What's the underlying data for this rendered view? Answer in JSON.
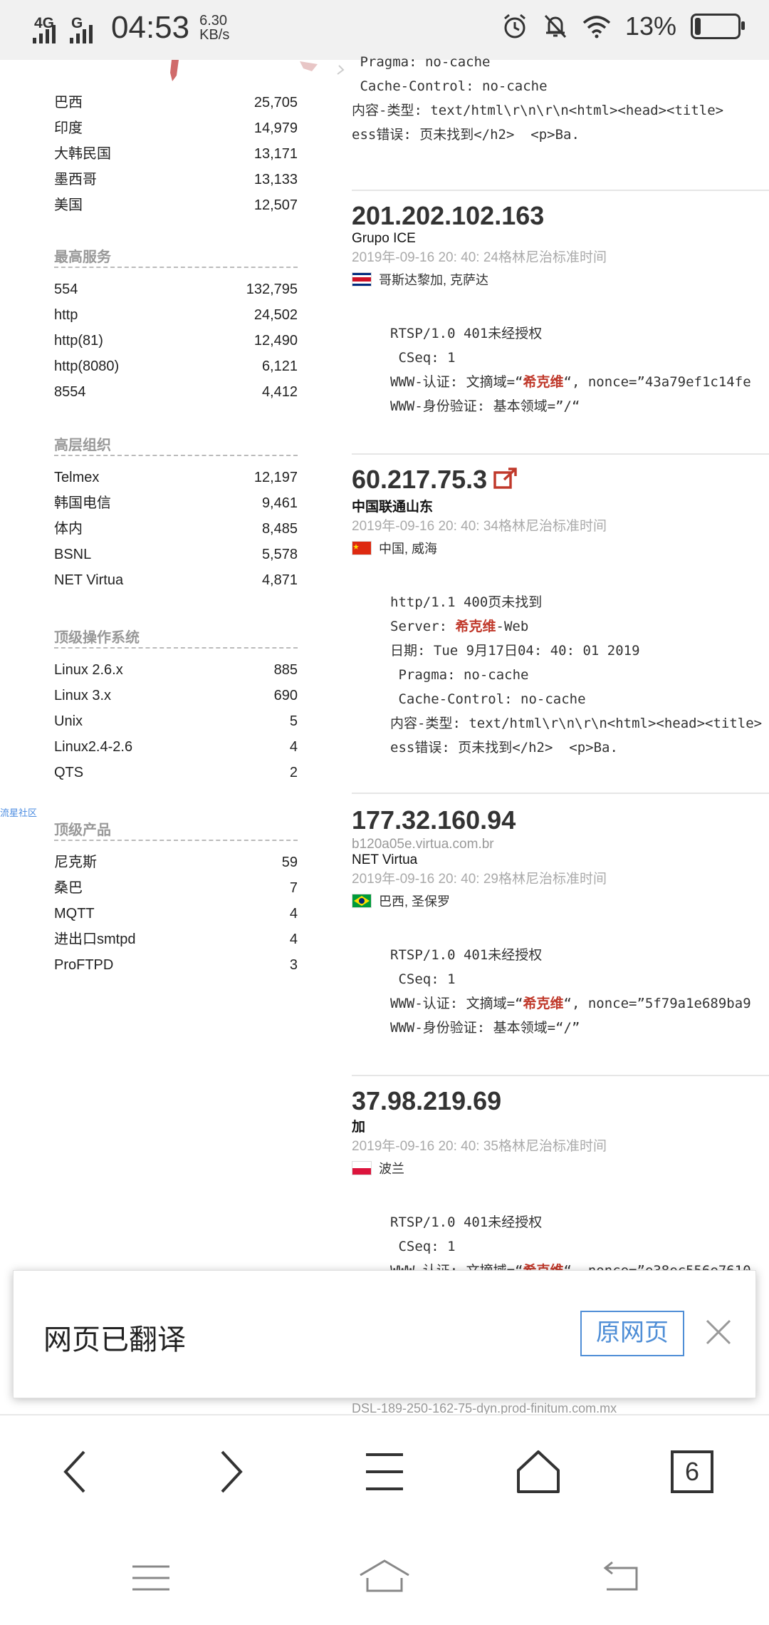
{
  "status_bar": {
    "network1": "4G",
    "network2": "G",
    "time": "04:53",
    "speed_value": "6.30",
    "speed_unit": "KB/s",
    "battery_percent": "13%",
    "battery_level": 0.13
  },
  "facets": [
    {
      "title": "",
      "rows": [
        {
          "label": "巴西",
          "value": "25,705"
        },
        {
          "label": "印度",
          "value": "14,979"
        },
        {
          "label": "大韩民国",
          "value": "13,171"
        },
        {
          "label": "墨西哥",
          "value": "13,133"
        },
        {
          "label": "美国",
          "value": "12,507"
        }
      ]
    },
    {
      "title": "最高服务",
      "rows": [
        {
          "label": "554",
          "value": "132,795"
        },
        {
          "label": "http",
          "value": "24,502"
        },
        {
          "label": "http(81)",
          "value": "12,490"
        },
        {
          "label": "http(8080)",
          "value": "6,121"
        },
        {
          "label": "8554",
          "value": "4,412"
        }
      ]
    },
    {
      "title": "高层组织",
      "rows": [
        {
          "label": "Telmex",
          "value": "12,197"
        },
        {
          "label": "韩国电信",
          "value": "9,461"
        },
        {
          "label": "体内",
          "value": "8,485"
        },
        {
          "label": "BSNL",
          "value": "5,578"
        },
        {
          "label": "NET Virtua",
          "value": "4,871"
        }
      ]
    },
    {
      "title": "顶级操作系统",
      "rows": [
        {
          "label": "Linux 2.6.x",
          "value": "885"
        },
        {
          "label": "Linux 3.x",
          "value": "690"
        },
        {
          "label": "Unix",
          "value": "5"
        },
        {
          "label": "Linux2.4-2.6",
          "value": "4"
        },
        {
          "label": "QTS",
          "value": "2"
        }
      ]
    },
    {
      "title": "顶级产品",
      "rows": [
        {
          "label": "尼克斯",
          "value": "59"
        },
        {
          "label": "桑巴",
          "value": "7"
        },
        {
          "label": "MQTT",
          "value": "4"
        },
        {
          "label": "进出口smtpd",
          "value": "4"
        },
        {
          "label": "ProFTPD",
          "value": "3"
        }
      ]
    }
  ],
  "community_link": "流星社区",
  "partial_top_banner": [
    " Pragma: no-cache",
    " Cache-Control: no-cache",
    "内容-类型: text/html\\r\\n\\r\\n<html><head><title>",
    "ess错误: 页未找到</h2>  <p>Ba."
  ],
  "results": [
    {
      "ip": "201.202.102.163",
      "host": "",
      "org": "Grupo ICE",
      "timestamp": "2019年-09-16 20: 40: 24格林尼治标准时间",
      "location": "哥斯达黎加, 克萨达",
      "flag": "cr",
      "external_link": false,
      "banner_lines": [
        [
          "RTSP/1.0 401未经授权"
        ],
        [
          " CSeq: 1"
        ],
        [
          "WWW-认证: 文摘域=“",
          "希克维",
          "“, nonce=”43a79ef1c14fe"
        ],
        [
          "WWW-身份验证: 基本领域=”/“"
        ]
      ]
    },
    {
      "ip": "60.217.75.3",
      "host": "",
      "org": "中国联通山东",
      "timestamp": "2019年-09-16 20: 40: 34格林尼治标准时间",
      "location": "中国, 威海",
      "flag": "cn",
      "external_link": true,
      "banner_lines": [
        [
          "http/1.1 400页未找到"
        ],
        [
          "Server: ",
          "希克维",
          "-Web"
        ],
        [
          "日期: Tue 9月17日04: 40: 01 2019"
        ],
        [
          " Pragma: no-cache"
        ],
        [
          " Cache-Control: no-cache"
        ],
        [
          "内容-类型: text/html\\r\\n\\r\\n<html><head><title>"
        ],
        [
          "ess错误: 页未找到</h2>  <p>Ba."
        ]
      ]
    },
    {
      "ip": "177.32.160.94",
      "host": "b120a05e.virtua.com.br",
      "org": "NET Virtua",
      "timestamp": "2019年-09-16 20: 40: 29格林尼治标准时间",
      "location": "巴西, 圣保罗",
      "flag": "br",
      "external_link": false,
      "banner_lines": [
        [
          "RTSP/1.0 401未经授权"
        ],
        [
          " CSeq: 1"
        ],
        [
          "WWW-认证: 文摘域=“",
          "希克维",
          "“, nonce=”5f79a1e689ba9"
        ],
        [
          "WWW-身份验证: 基本领域=“/”"
        ]
      ]
    },
    {
      "ip": "37.98.219.69",
      "host": "",
      "org": "加",
      "timestamp": "2019年-09-16 20: 40: 35格林尼治标准时间",
      "location": "波兰",
      "flag": "pl",
      "external_link": false,
      "banner_lines": [
        [
          "RTSP/1.0 401未经授权"
        ],
        [
          " CSeq: 1"
        ],
        [
          "WWW-认证: 文摘域=“",
          "希克维",
          "“, nonce=”e38ec556e7610"
        ]
      ]
    }
  ],
  "translate_bar": {
    "message": "网页已翻译",
    "original_button": "原网页"
  },
  "bottom_host": "DSL-189-250-162-75-dyn.prod-finitum.com.mx",
  "browser_toolbar": {
    "tab_count": "6"
  }
}
